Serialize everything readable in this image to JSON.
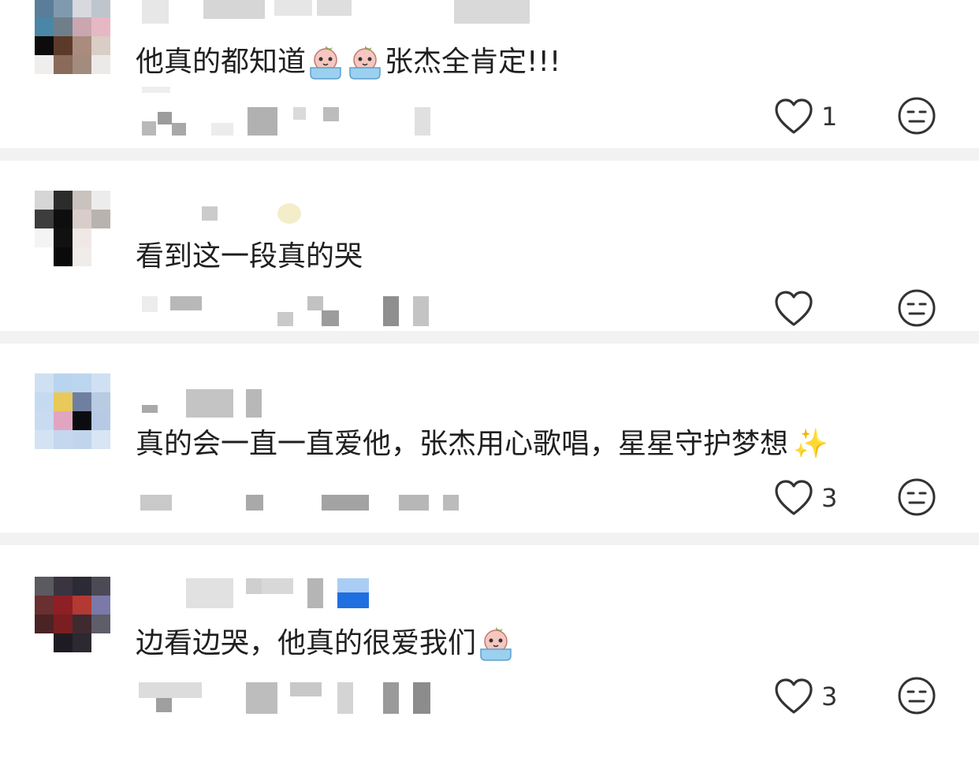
{
  "comments": [
    {
      "text": "他真的都知道",
      "text_after_emoji": "张杰全肯定!!!",
      "emoji_before_text_after": [
        "crying-face-emoji",
        "crying-face-emoji"
      ],
      "like_count": "1"
    },
    {
      "text": "看到这一段真的哭",
      "like_count": ""
    },
    {
      "text": "真的会一直一直爱他，张杰用心歌唱，星星守护梦想",
      "trailing_emoji": "✨",
      "like_count": "3"
    },
    {
      "text": "边看边哭，他真的很爱我们",
      "trailing_emoji_name": "crying-face-emoji",
      "like_count": "3"
    }
  ],
  "icons": {
    "like": "heart-outline-icon",
    "dislike": "meh-face-icon"
  },
  "colors": {
    "text": "#1f1f1f",
    "icon": "#333333",
    "separator": "#f2f2f2"
  }
}
